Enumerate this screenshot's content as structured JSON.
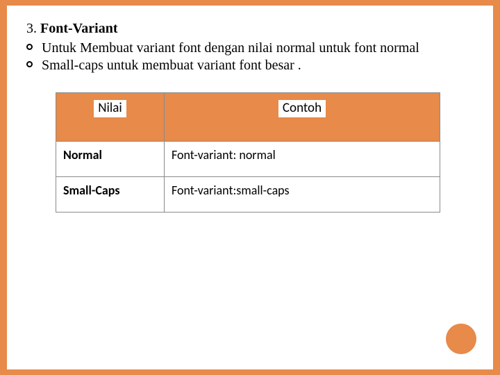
{
  "heading": {
    "number": "3.",
    "title": "Font-Variant"
  },
  "bullets": [
    "Untuk Membuat variant font dengan nilai normal  untuk font normal",
    "Small-caps untuk membuat variant font besar ."
  ],
  "table": {
    "headers": {
      "col1": "Nilai",
      "col2": "Contoh"
    },
    "rows": [
      {
        "value": "Normal",
        "example": "Font-variant: normal"
      },
      {
        "value": "Small-Caps",
        "example": "Font-variant:small-caps"
      }
    ]
  }
}
